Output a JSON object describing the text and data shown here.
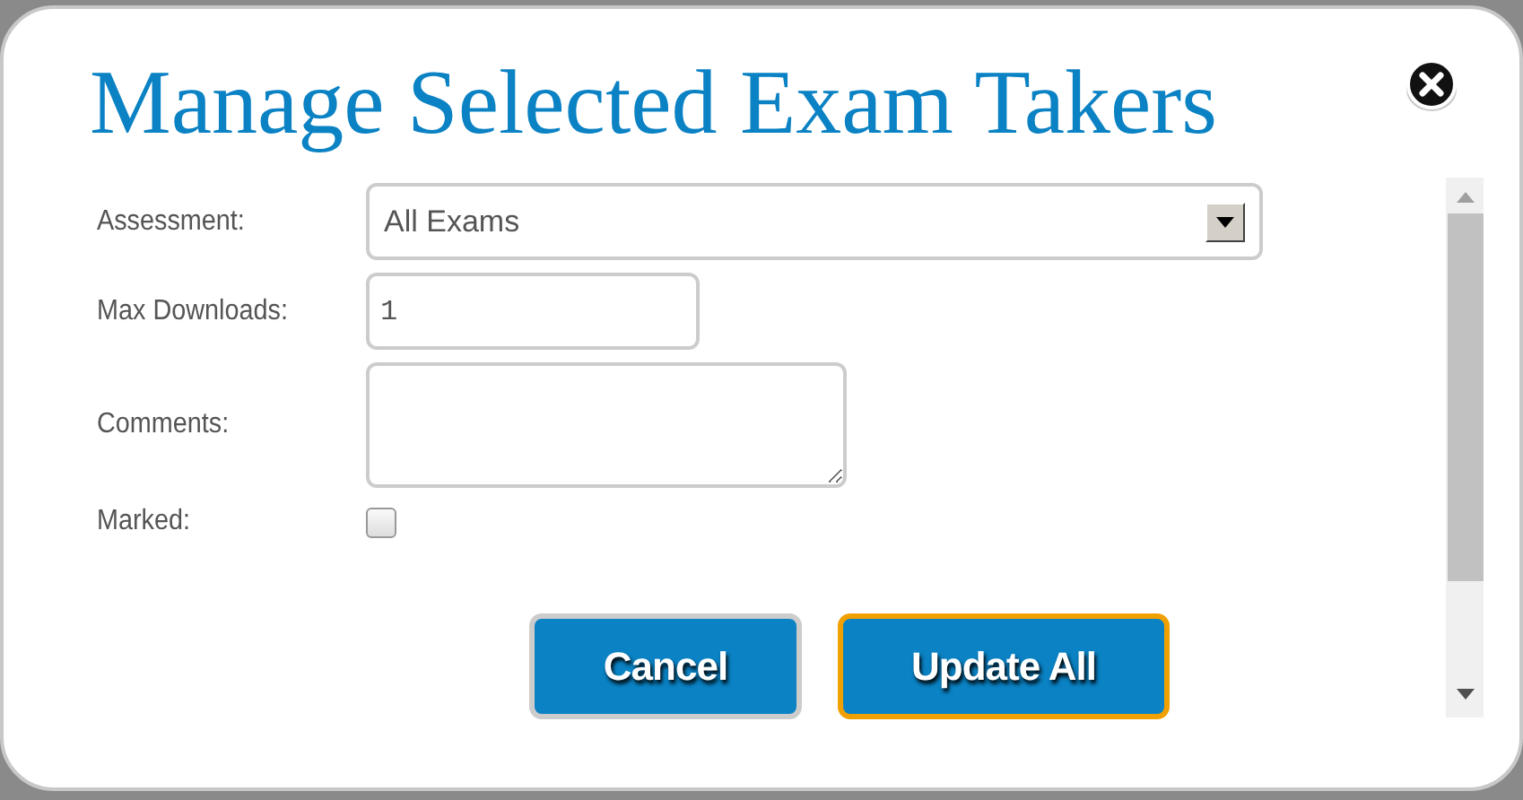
{
  "dialog": {
    "title": "Manage Selected Exam Takers"
  },
  "fields": [
    {
      "kind": "select",
      "label": "Assessment:",
      "value": "All Exams"
    },
    {
      "kind": "text",
      "label": "Max Downloads:",
      "value": "1"
    },
    {
      "kind": "textarea",
      "label": "Comments:"
    },
    {
      "kind": "checkbox",
      "label": "Marked:",
      "checked": false
    }
  ],
  "buttons": [
    {
      "label": "Cancel",
      "focused": false
    },
    {
      "label": "Update All",
      "focused": true
    }
  ]
}
